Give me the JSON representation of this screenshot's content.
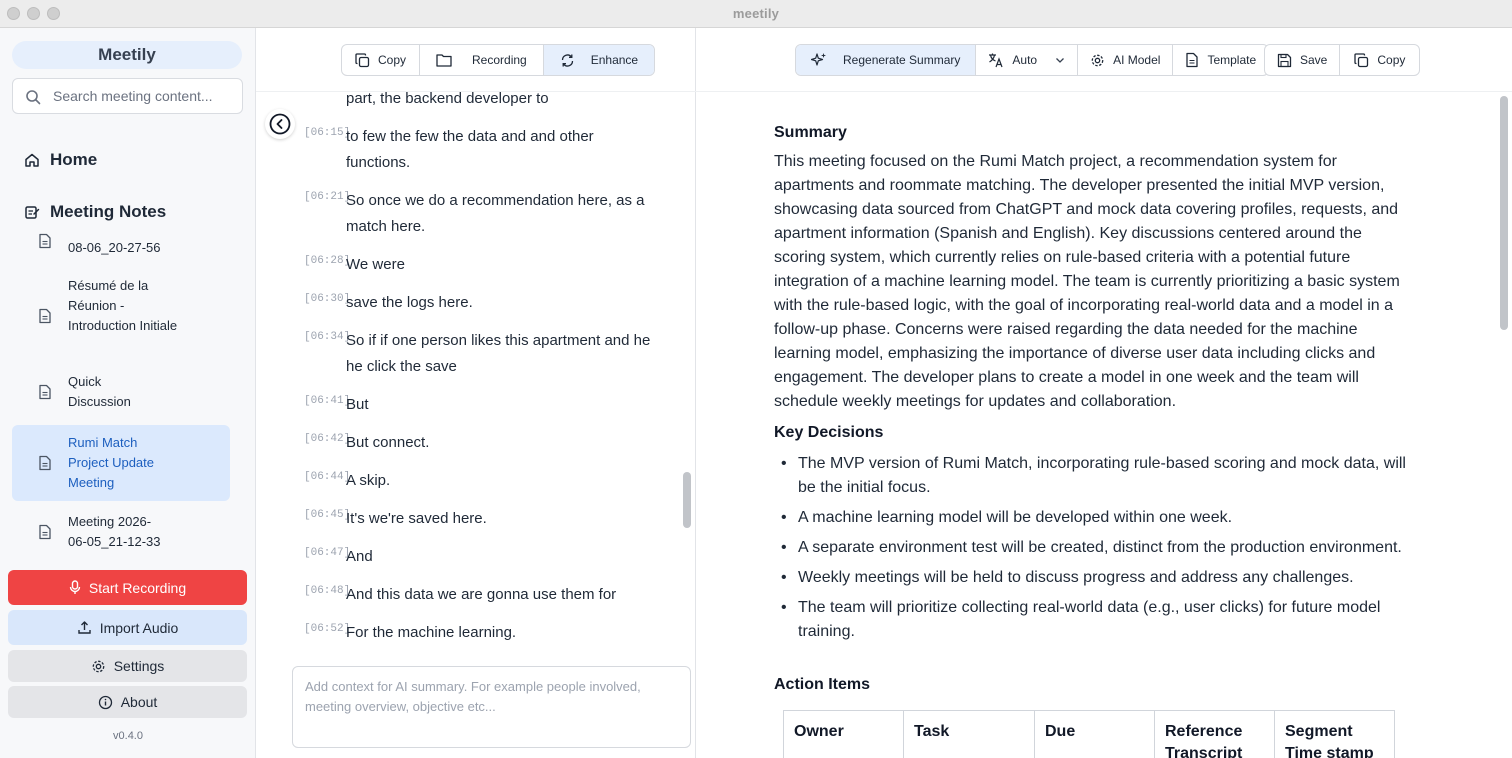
{
  "window": {
    "title": "meetily"
  },
  "sidebar": {
    "brand": "Meetily",
    "search_placeholder": "Search meeting content...",
    "home_label": "Home",
    "notes_label": "Meeting Notes",
    "notes": [
      {
        "label": "08-06_20-27-56",
        "active": false
      },
      {
        "label": "Résumé de la Réunion - Introduction Initiale",
        "active": false
      },
      {
        "label": "Quick Discussion",
        "active": false
      },
      {
        "label": "Rumi Match Project Update Meeting",
        "active": true
      },
      {
        "label": "Meeting 2026-06-05_21-12-33",
        "active": false
      }
    ],
    "start_recording": "Start Recording",
    "import_audio": "Import Audio",
    "settings": "Settings",
    "about": "About",
    "version": "v0.4.0"
  },
  "transcript_toolbar": {
    "copy": "Copy",
    "recording": "Recording",
    "enhance": "Enhance"
  },
  "transcript": [
    {
      "time": "",
      "text": "part, the backend developer to"
    },
    {
      "time": "[06:15]",
      "text": "to few the few the data and and other functions."
    },
    {
      "time": "[06:21]",
      "text": "So once we do a recommendation here, as a match here."
    },
    {
      "time": "[06:28]",
      "text": "We were"
    },
    {
      "time": "[06:30]",
      "text": "save the logs here."
    },
    {
      "time": "[06:34]",
      "text": "So if if one person likes this apartment and he he click the save"
    },
    {
      "time": "[06:41]",
      "text": "But"
    },
    {
      "time": "[06:42]",
      "text": "But connect."
    },
    {
      "time": "[06:44]",
      "text": "A skip."
    },
    {
      "time": "[06:45]",
      "text": "It's we're saved here."
    },
    {
      "time": "[06:47]",
      "text": "And"
    },
    {
      "time": "[06:48]",
      "text": "And this data we are gonna use them for"
    },
    {
      "time": "[06:52]",
      "text": "For the machine learning."
    }
  ],
  "context_placeholder": "Add context for AI summary. For example people involved, meeting overview, objective etc...",
  "summary_toolbar": {
    "regenerate": "Regenerate Summary",
    "language": "Auto",
    "ai_model": "AI Model",
    "template": "Template",
    "save": "Save",
    "copy": "Copy"
  },
  "summary": {
    "summary_heading": "Summary",
    "summary_text": "This meeting focused on the Rumi Match project, a recommendation system for apartments and roommate matching. The developer presented the initial MVP version, showcasing data sourced from ChatGPT and mock data covering profiles, requests, and apartment information (Spanish and English). Key discussions centered around the scoring system, which currently relies on rule-based criteria with a potential future integration of a machine learning model. The team is currently prioritizing a basic system with the rule-based logic, with the goal of incorporating real-world data and a model in a follow-up phase. Concerns were raised regarding the data needed for the machine learning model, emphasizing the importance of diverse user data including clicks and engagement. The developer plans to create a model in one week and the team will schedule weekly meetings for updates and collaboration.",
    "decisions_heading": "Key Decisions",
    "decisions": [
      "The MVP version of Rumi Match, incorporating rule-based scoring and mock data, will be the initial focus.",
      "A machine learning model will be developed within one week.",
      "A separate environment test will be created, distinct from the production environment.",
      "Weekly meetings will be held to discuss progress and address any challenges.",
      "The team will prioritize collecting real-world data (e.g., user clicks) for future model training."
    ],
    "actions_heading": "Action Items",
    "table_headers": [
      "Owner",
      "Task",
      "Due",
      "Reference Transcript",
      "Segment Time stamp"
    ]
  },
  "colors": {
    "accent": "#1d5fbf",
    "record": "#ef4444",
    "active_bg": "#dbe9fd"
  }
}
